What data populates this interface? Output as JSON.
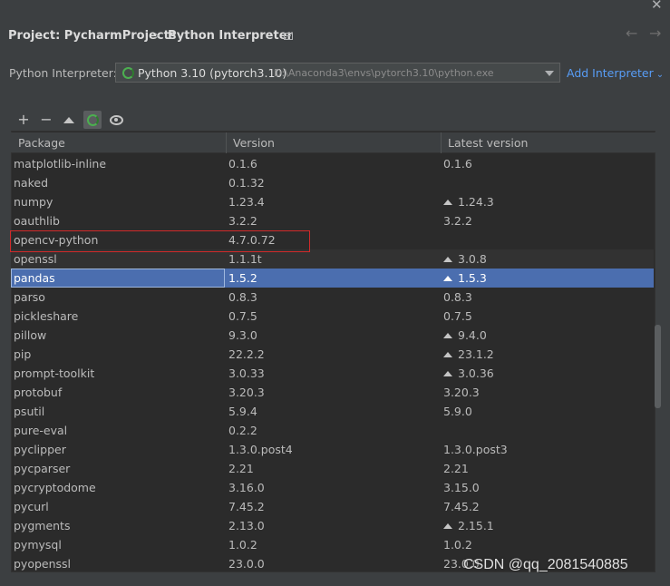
{
  "window": {
    "close_glyph": "✕"
  },
  "breadcrumb": {
    "project": "Project: PycharmProjects",
    "separator": "›",
    "page": "Python Interpreter"
  },
  "nav": {
    "back": "←",
    "forward": "→"
  },
  "interpreter": {
    "label": "Python Interpreter:",
    "name": "Python 3.10 (pytorch3.10)",
    "path": "D:\\Anaconda3\\envs\\pytorch3.10\\python.exe",
    "add_label": "Add Interpreter",
    "add_caret": "⌄"
  },
  "toolbar": {
    "plus": "+",
    "minus": "−"
  },
  "table": {
    "headers": {
      "package": "Package",
      "version": "Version",
      "latest": "Latest version"
    },
    "rows": [
      {
        "package": "matplotlib-inline",
        "version": "0.1.6",
        "latest": "0.1.6",
        "upgrade": false
      },
      {
        "package": "naked",
        "version": "0.1.32",
        "latest": "",
        "upgrade": false
      },
      {
        "package": "numpy",
        "version": "1.23.4",
        "latest": "1.24.3",
        "upgrade": true
      },
      {
        "package": "oauthlib",
        "version": "3.2.2",
        "latest": "3.2.2",
        "upgrade": false
      },
      {
        "package": "opencv-python",
        "version": "4.7.0.72",
        "latest": "",
        "upgrade": false
      },
      {
        "package": "openssl",
        "version": "1.1.1t",
        "latest": "3.0.8",
        "upgrade": true
      },
      {
        "package": "pandas",
        "version": "1.5.2",
        "latest": "1.5.3",
        "upgrade": true
      },
      {
        "package": "parso",
        "version": "0.8.3",
        "latest": "0.8.3",
        "upgrade": false
      },
      {
        "package": "pickleshare",
        "version": "0.7.5",
        "latest": "0.7.5",
        "upgrade": false
      },
      {
        "package": "pillow",
        "version": "9.3.0",
        "latest": "9.4.0",
        "upgrade": true
      },
      {
        "package": "pip",
        "version": "22.2.2",
        "latest": "23.1.2",
        "upgrade": true
      },
      {
        "package": "prompt-toolkit",
        "version": "3.0.33",
        "latest": "3.0.36",
        "upgrade": true
      },
      {
        "package": "protobuf",
        "version": "3.20.3",
        "latest": "3.20.3",
        "upgrade": false
      },
      {
        "package": "psutil",
        "version": "5.9.4",
        "latest": "5.9.0",
        "upgrade": false
      },
      {
        "package": "pure-eval",
        "version": "0.2.2",
        "latest": "",
        "upgrade": false
      },
      {
        "package": "pyclipper",
        "version": "1.3.0.post4",
        "latest": "1.3.0.post3",
        "upgrade": false
      },
      {
        "package": "pycparser",
        "version": "2.21",
        "latest": "2.21",
        "upgrade": false
      },
      {
        "package": "pycryptodome",
        "version": "3.16.0",
        "latest": "3.15.0",
        "upgrade": false
      },
      {
        "package": "pycurl",
        "version": "7.45.2",
        "latest": "7.45.2",
        "upgrade": false
      },
      {
        "package": "pygments",
        "version": "2.13.0",
        "latest": "2.15.1",
        "upgrade": true
      },
      {
        "package": "pymysql",
        "version": "1.0.2",
        "latest": "1.0.2",
        "upgrade": false
      },
      {
        "package": "pyopenssl",
        "version": "23.0.0",
        "latest": "23.0.0",
        "upgrade": false
      }
    ],
    "selected_index": 6,
    "highlighted_index": 4
  },
  "watermark": "CSDN @qq_2081540885",
  "colors": {
    "background": "#3c3f41",
    "table_bg": "#2b2b2b",
    "selection": "#4b6eaf",
    "link": "#589df6",
    "highlight_box": "#d12a2a",
    "conda_green": "#4caf50"
  }
}
